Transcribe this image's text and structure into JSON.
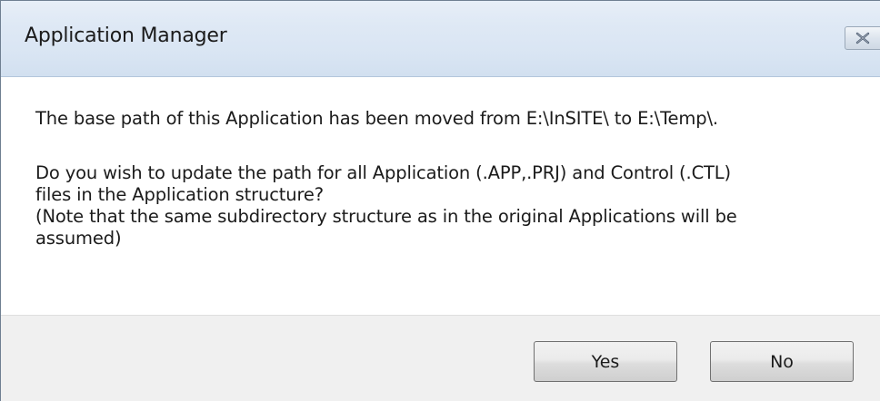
{
  "window": {
    "title": "Application Manager",
    "close_icon": "close-icon"
  },
  "message": {
    "line1": "The base path of this Application has been moved from E:\\InSITE\\ to E:\\Temp\\.",
    "line2": "Do you wish to update the path for all Application (.APP,.PRJ) and Control (.CTL)",
    "line3": "files in the Application structure?",
    "line4": "(Note that the same subdirectory structure as in the original Applications will be",
    "line5": "assumed)"
  },
  "buttons": {
    "yes_label": "Yes",
    "no_label": "No"
  },
  "colors": {
    "titlebar": "#dce7f4",
    "footer": "#f0f0f0",
    "text": "#1b1b1b"
  }
}
